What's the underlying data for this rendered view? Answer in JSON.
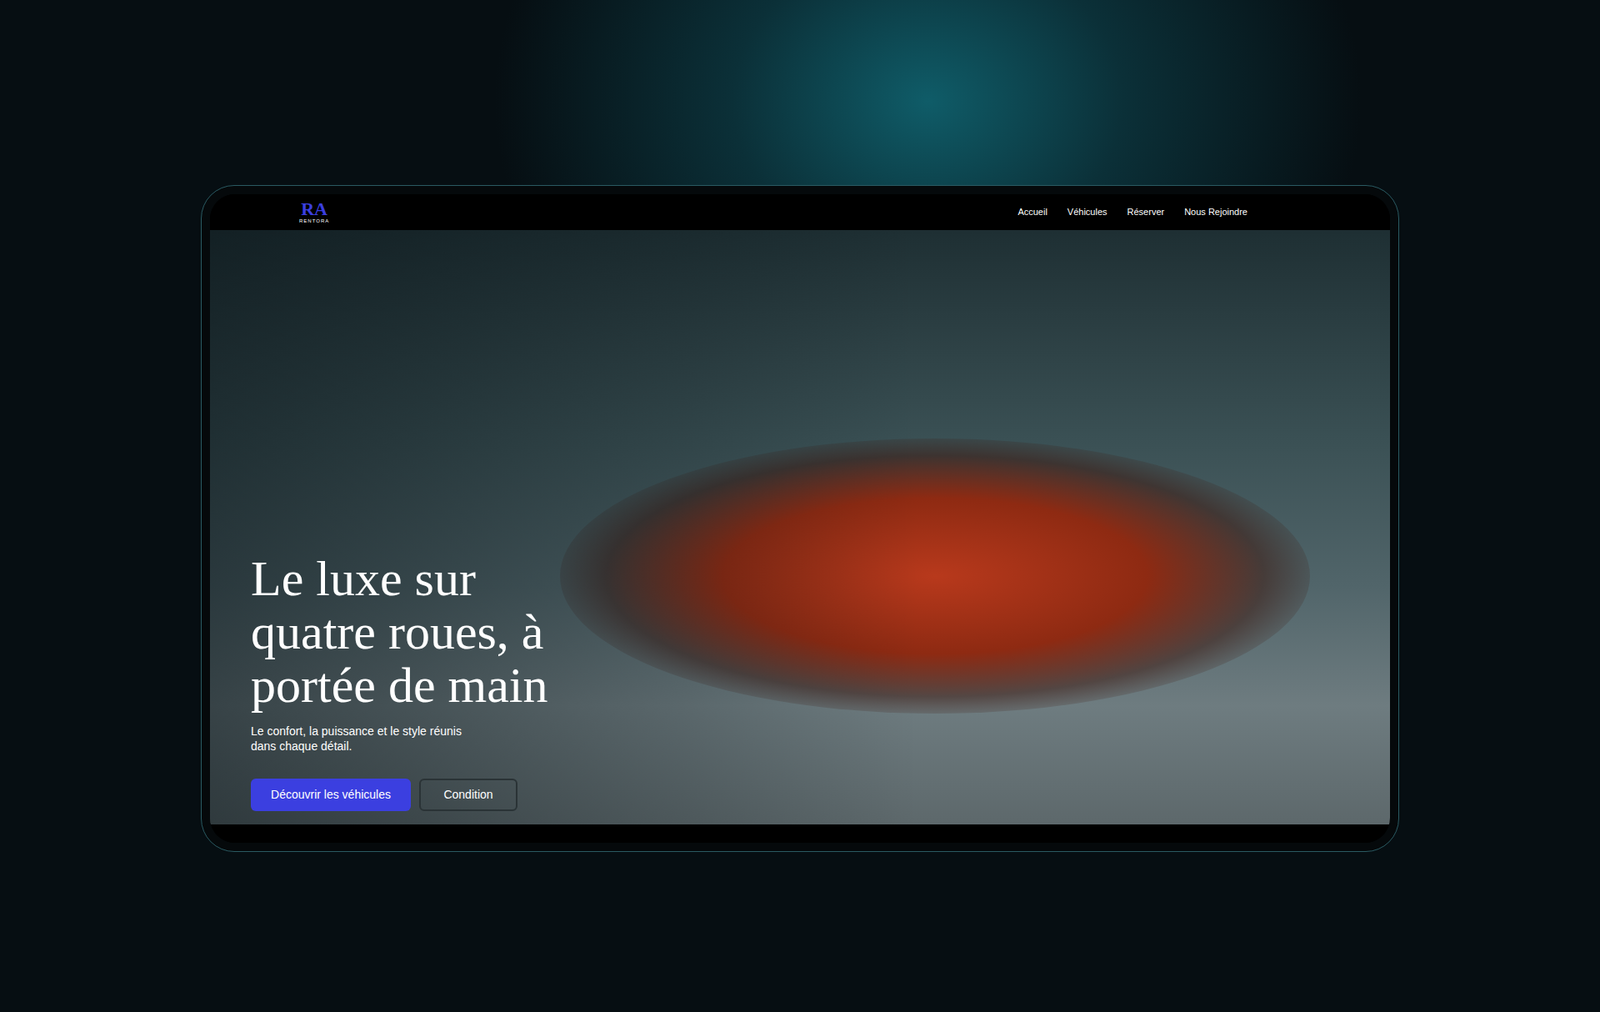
{
  "nav": {
    "logo": {
      "mark": "RA",
      "wordmark": "RENTORA"
    },
    "links": [
      {
        "label": "Accueil"
      },
      {
        "label": "Véhicules"
      },
      {
        "label": "Réserver"
      },
      {
        "label": "Nous Rejoindre"
      }
    ]
  },
  "hero": {
    "title_lines": [
      "Le luxe sur",
      "quatre roues, à",
      "portée de main"
    ],
    "subtitle_lines": [
      "Le confort, la puissance et le style réunis",
      "dans chaque détail."
    ],
    "buttons": [
      {
        "label": "Découvrir les véhicules",
        "kind": "primary"
      },
      {
        "label": "Condition",
        "kind": "outline"
      }
    ]
  }
}
